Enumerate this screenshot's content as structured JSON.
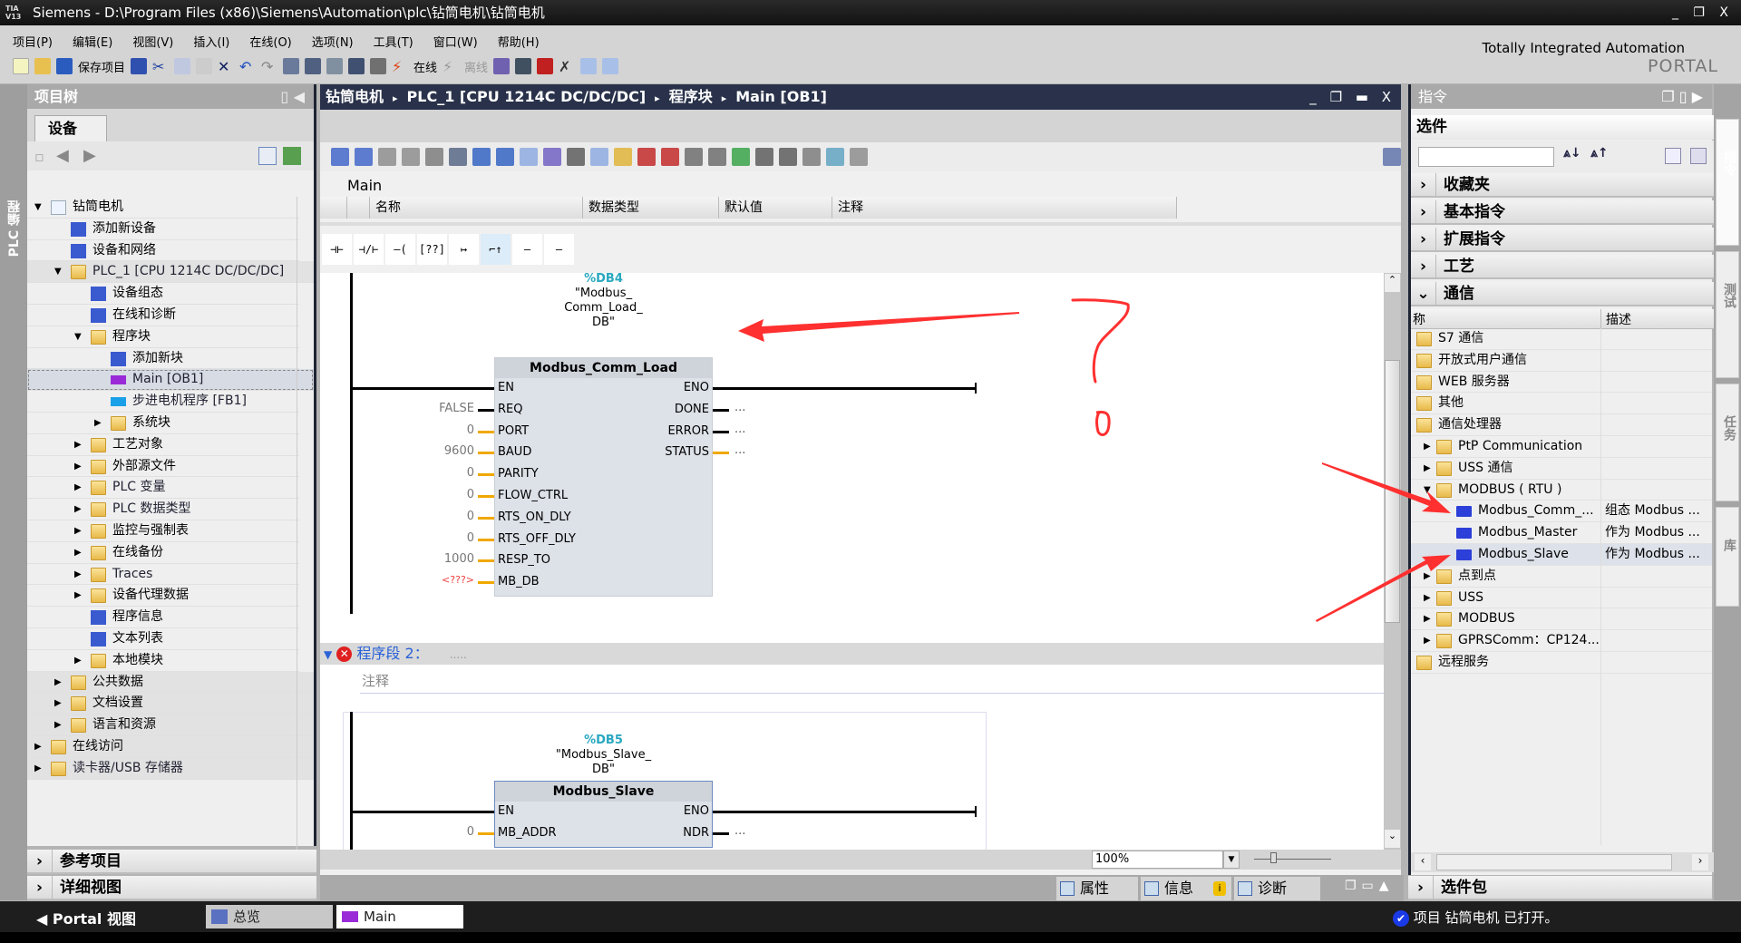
{
  "window": {
    "logo": "TIA V13",
    "title": "Siemens  -  D:\\Program Files (x86)\\Siemens\\Automation\\plc\\钻筒电机\\钻筒电机",
    "controls": "_ ❐ X"
  },
  "menu": [
    "项目(P)",
    "编辑(E)",
    "视图(V)",
    "插入(I)",
    "在线(O)",
    "选项(N)",
    "工具(T)",
    "窗口(W)",
    "帮助(H)"
  ],
  "toolbar": {
    "save_label": "保存项目",
    "online_label": "在线",
    "offline_label": "离线"
  },
  "brand": {
    "line1": "Totally Integrated Automation",
    "line2": "PORTAL"
  },
  "left_strip": {
    "label": "PLC 编程"
  },
  "project_tree": {
    "title": "项目树",
    "tab": "设备",
    "items": [
      {
        "label": "钻筒电机",
        "level": 0,
        "exp": "open",
        "icon": "project-icon"
      },
      {
        "label": "添加新设备",
        "level": 1,
        "exp": "",
        "icon": "add-device-icon"
      },
      {
        "label": "设备和网络",
        "level": 1,
        "exp": "",
        "icon": "network-icon"
      },
      {
        "label": "PLC_1 [CPU 1214C DC/DC/DC]",
        "level": 1,
        "exp": "open",
        "icon": "plc-icon",
        "grey": true
      },
      {
        "label": "设备组态",
        "level": 2,
        "exp": "",
        "icon": "device-config-icon"
      },
      {
        "label": "在线和诊断",
        "level": 2,
        "exp": "",
        "icon": "diagnostics-icon"
      },
      {
        "label": "程序块",
        "level": 2,
        "exp": "open",
        "icon": "folder-icon"
      },
      {
        "label": "添加新块",
        "level": 3,
        "exp": "",
        "icon": "add-block-icon"
      },
      {
        "label": "Main [OB1]",
        "level": 3,
        "exp": "",
        "icon": "ob-block-icon",
        "selected": true
      },
      {
        "label": "步进电机程序 [FB1]",
        "level": 3,
        "exp": "",
        "icon": "fb-block-icon"
      },
      {
        "label": "系统块",
        "level": 3,
        "exp": "closed",
        "icon": "folder-icon"
      },
      {
        "label": "工艺对象",
        "level": 2,
        "exp": "closed",
        "icon": "folder-icon"
      },
      {
        "label": "外部源文件",
        "level": 2,
        "exp": "closed",
        "icon": "folder-icon"
      },
      {
        "label": "PLC 变量",
        "level": 2,
        "exp": "closed",
        "icon": "folder-icon"
      },
      {
        "label": "PLC 数据类型",
        "level": 2,
        "exp": "closed",
        "icon": "folder-icon"
      },
      {
        "label": "监控与强制表",
        "level": 2,
        "exp": "closed",
        "icon": "folder-icon"
      },
      {
        "label": "在线备份",
        "level": 2,
        "exp": "closed",
        "icon": "folder-icon"
      },
      {
        "label": "Traces",
        "level": 2,
        "exp": "closed",
        "icon": "folder-icon"
      },
      {
        "label": "设备代理数据",
        "level": 2,
        "exp": "closed",
        "icon": "folder-icon"
      },
      {
        "label": "程序信息",
        "level": 2,
        "exp": "",
        "icon": "program-info-icon"
      },
      {
        "label": "文本列表",
        "level": 2,
        "exp": "",
        "icon": "text-list-icon"
      },
      {
        "label": "本地模块",
        "level": 2,
        "exp": "closed",
        "icon": "folder-icon"
      },
      {
        "label": "公共数据",
        "level": 1,
        "exp": "closed",
        "icon": "folder-icon",
        "grey": true
      },
      {
        "label": "文档设置",
        "level": 1,
        "exp": "closed",
        "icon": "folder-icon",
        "grey": true
      },
      {
        "label": "语言和资源",
        "level": 1,
        "exp": "closed",
        "icon": "folder-icon",
        "grey": true
      },
      {
        "label": "在线访问",
        "level": 0,
        "exp": "closed",
        "icon": "folder-icon",
        "grey": true
      },
      {
        "label": "读卡器/USB 存储器",
        "level": 0,
        "exp": "closed",
        "icon": "folder-icon",
        "grey": true
      }
    ],
    "ref_projects": "参考项目",
    "detail_view": "详细视图"
  },
  "editor": {
    "breadcrumb": [
      "钻筒电机",
      "PLC_1 [CPU 1214C DC/DC/DC]",
      "程序块",
      "Main [OB1]"
    ],
    "toolbar_icons": [
      "insert-network-icon",
      "delete-network-icon",
      "insert-row-icon",
      "add-row-icon",
      "branch-icon",
      "network-list-icon",
      "expand-icon",
      "collapse-icon",
      "comment-icon",
      "download-icon",
      "monitor-icon",
      "absolute-icon",
      "favorites-icon",
      "prev-error-icon",
      "next-error-icon",
      "update-icon",
      "compare-icon",
      "check-icon",
      "list-icon",
      "list2-icon",
      "search-icon",
      "simulate-icon",
      "book-icon"
    ],
    "block_name": "Main",
    "interface_columns": [
      "名称",
      "数据类型",
      "默认值",
      "注释"
    ],
    "lad_buttons": [
      "⊣⊢",
      "⊣/⊢",
      "–( )–",
      "[??]",
      "↦",
      "⌐↑",
      "–(R)–",
      "–(S)–"
    ],
    "network1": {
      "db": "%DB4",
      "instance": [
        "\"Modbus_",
        "Comm_Load_",
        "DB\""
      ],
      "block": "Modbus_Comm_Load",
      "inputs": [
        {
          "pin": "EN",
          "val": ""
        },
        {
          "pin": "REQ",
          "val": "FALSE"
        },
        {
          "pin": "PORT",
          "val": "0"
        },
        {
          "pin": "BAUD",
          "val": "9600"
        },
        {
          "pin": "PARITY",
          "val": "0"
        },
        {
          "pin": "FLOW_CTRL",
          "val": "0"
        },
        {
          "pin": "RTS_ON_DLY",
          "val": "0"
        },
        {
          "pin": "RTS_OFF_DLY",
          "val": "0"
        },
        {
          "pin": "RESP_TO",
          "val": "1000"
        },
        {
          "pin": "MB_DB",
          "val": "<???>"
        }
      ],
      "outputs": [
        {
          "pin": "ENO",
          "val": ""
        },
        {
          "pin": "DONE",
          "val": "..."
        },
        {
          "pin": "ERROR",
          "val": "..."
        },
        {
          "pin": "STATUS",
          "val": "..."
        }
      ]
    },
    "network2": {
      "title": "程序段 2：",
      "dots": ".....",
      "comment": "注释",
      "db": "%DB5",
      "instance": [
        "\"Modbus_Slave_",
        "DB\""
      ],
      "block": "Modbus_Slave",
      "inputs": [
        {
          "pin": "EN",
          "val": ""
        },
        {
          "pin": "MB_ADDR",
          "val": "0"
        }
      ],
      "outputs": [
        {
          "pin": "ENO",
          "val": ""
        },
        {
          "pin": "NDR",
          "val": "..."
        }
      ]
    },
    "zoom": "100%"
  },
  "inspector_tabs": [
    "属性",
    "信息",
    "诊断"
  ],
  "instructions": {
    "title": "指令",
    "options": "选件",
    "search_value": "",
    "categories": [
      {
        "label": "收藏夹",
        "open": false
      },
      {
        "label": "基本指令",
        "open": false
      },
      {
        "label": "扩展指令",
        "open": false
      },
      {
        "label": "工艺",
        "open": false
      },
      {
        "label": "通信",
        "open": true
      }
    ],
    "columns": [
      "称",
      "描述"
    ],
    "rows": [
      {
        "label": "S7 通信",
        "level": 0,
        "exp": "",
        "type": "folder"
      },
      {
        "label": "开放式用户通信",
        "level": 0,
        "exp": "",
        "type": "folder"
      },
      {
        "label": "WEB 服务器",
        "level": 0,
        "exp": "",
        "type": "folder"
      },
      {
        "label": "其他",
        "level": 0,
        "exp": "",
        "type": "folder"
      },
      {
        "label": "通信处理器",
        "level": 0,
        "exp": "",
        "type": "folder"
      },
      {
        "label": "PtP Communication",
        "level": 1,
        "exp": "closed",
        "type": "folder"
      },
      {
        "label": "USS 通信",
        "level": 1,
        "exp": "closed",
        "type": "folder"
      },
      {
        "label": "MODBUS ( RTU )",
        "level": 1,
        "exp": "open",
        "type": "folder"
      },
      {
        "label": "Modbus_Comm_...",
        "level": 2,
        "exp": "",
        "type": "block",
        "desc": "组态 Modbus ..."
      },
      {
        "label": "Modbus_Master",
        "level": 2,
        "exp": "",
        "type": "block",
        "desc": "作为 Modbus ..."
      },
      {
        "label": "Modbus_Slave",
        "level": 2,
        "exp": "",
        "type": "block",
        "desc": "作为 Modbus ...",
        "selected": true
      },
      {
        "label": "点到点",
        "level": 1,
        "exp": "closed",
        "type": "folder"
      },
      {
        "label": "USS",
        "level": 1,
        "exp": "closed",
        "type": "folder"
      },
      {
        "label": "MODBUS",
        "level": 1,
        "exp": "closed",
        "type": "folder"
      },
      {
        "label": "GPRSComm：CP124...",
        "level": 1,
        "exp": "closed",
        "type": "folder"
      },
      {
        "label": "远程服务",
        "level": 0,
        "exp": "",
        "type": "folder"
      }
    ],
    "package": "选件包"
  },
  "side_tabs": [
    "指令",
    "测试",
    "任务",
    "库"
  ],
  "taskbar": {
    "portal": "Portal 视图",
    "overview": "总览",
    "main": "Main",
    "status": "项目 钻筒电机 已打开。"
  },
  "colors": {
    "breadcrumb_bg": "#29324a",
    "db_label": "#28a8c0",
    "annotation": "#ff3030",
    "network_title": "#2a62d8",
    "selection": "#d6dbe4"
  }
}
